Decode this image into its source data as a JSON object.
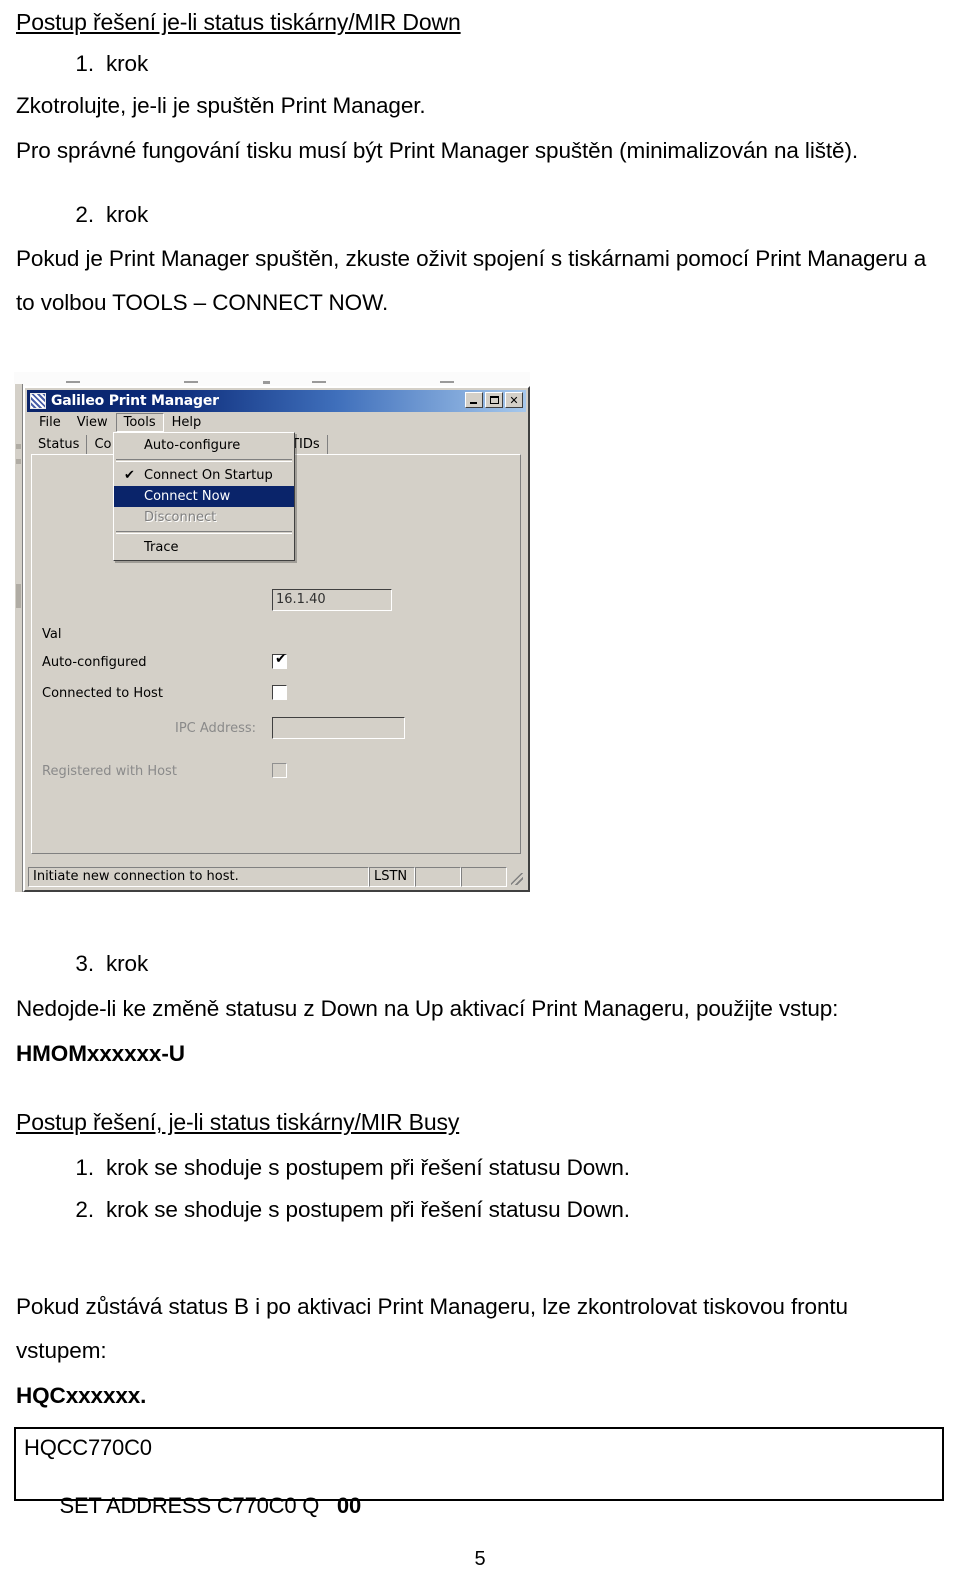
{
  "document": {
    "heading1": "Postup řešení je-li status tiskárny/MIR Down",
    "step1_num": "1.",
    "step1_label": "krok",
    "para1": "Zkotrolujte, je-li je spuštěn Print Manager.",
    "para2": "Pro správné fungování tisku musí být Print Manager spuštěn (minimalizován na liště).",
    "step2_num": "2.",
    "step2_label": "krok",
    "para3": "Pokud je Print Manager spuštěn, zkuste oživit spojení s tiskárnami pomocí Print Manageru a",
    "para4": "to volbou TOOLS – CONNECT NOW.",
    "step3_num": "3.",
    "step3_label": "krok",
    "para5": "Nedojde-li ke změně statusu z Down na Up aktivací Print Manageru, použijte vstup:",
    "code1": "HMOMxxxxxx-U",
    "heading2": "Postup řešení, je-li status tiskárny/MIR Busy",
    "busy_step1_num": "1.",
    "busy_step1_text": "krok se shoduje s postupem při řešení statusu Down.",
    "busy_step2_num": "2.",
    "busy_step2_text": "krok se shoduje s postupem při řešení statusu Down.",
    "para6": "Pokud zůstává status B i po aktivaci Print Manageru, lze zkontrolovat tiskovou frontu",
    "para7": "vstupem:",
    "code2": "HQCxxxxxx.",
    "terminal_line1": "HQCC770C0",
    "terminal_line2_plain": "SET ADDRESS C770C0 Q   ",
    "terminal_line2_bold": "00",
    "page_number": "5"
  },
  "screenshot": {
    "window_title": "Galileo Print Manager",
    "titlebar_buttons": {
      "minimize": "minimize-icon",
      "maximize": "maximize-icon",
      "close": "✕"
    },
    "menubar": [
      "File",
      "View",
      "Tools",
      "Help"
    ],
    "tabs": [
      "Status",
      "Co",
      "GTIDs"
    ],
    "dropdown": {
      "owner": "Tools",
      "items": [
        {
          "label": "Auto-configure",
          "checked": false,
          "disabled": false,
          "highlighted": false
        },
        {
          "label": "Connect On Startup",
          "checked": true,
          "disabled": false,
          "highlighted": false
        },
        {
          "label": "Connect Now",
          "checked": false,
          "disabled": false,
          "highlighted": true
        },
        {
          "label": "Disconnect",
          "checked": false,
          "disabled": true,
          "highlighted": false
        },
        {
          "label": "Trace",
          "checked": false,
          "disabled": false,
          "highlighted": false
        }
      ]
    },
    "fields": {
      "ip_value": "16.1.40",
      "value_label": "Val",
      "auto_configured_label": "Auto-configured",
      "auto_configured_checked": "✔",
      "connected_to_host_label": "Connected to Host",
      "ipc_address_label": "IPC Address:",
      "ipc_address_value": "",
      "registered_with_host_label": "Registered with Host"
    },
    "statusbar": {
      "message": "Initiate new connection to host.",
      "cell1": "LSTN",
      "cell2": "",
      "cell3": ""
    },
    "colors": {
      "titlebar_start": "#0a246a",
      "titlebar_end": "#a6c8ec",
      "window_face": "#d4d0c8",
      "highlight": "#0a246a"
    }
  }
}
